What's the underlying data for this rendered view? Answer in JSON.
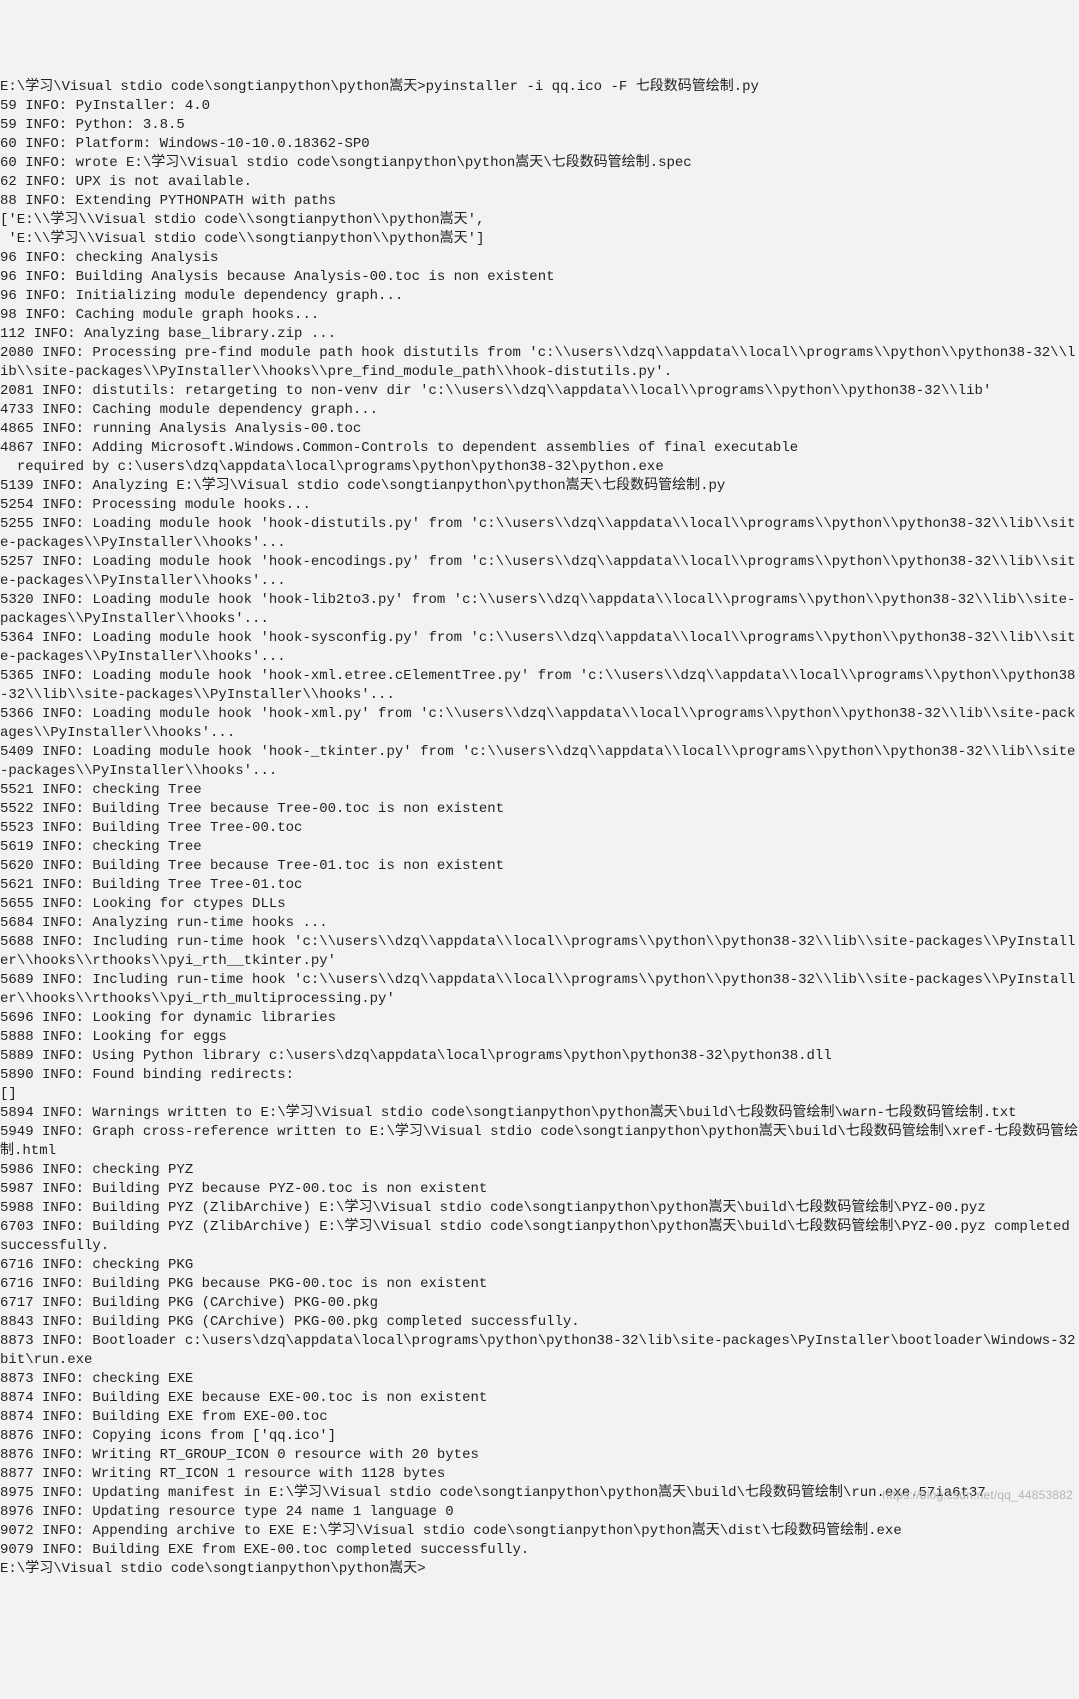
{
  "prompt1": "E:\\学习\\Visual stdio code\\songtianpython\\python嵩天>pyinstaller -i qq.ico -F 七段数码管绘制.py",
  "lines": [
    "59 INFO: PyInstaller: 4.0",
    "59 INFO: Python: 3.8.5",
    "60 INFO: Platform: Windows-10-10.0.18362-SP0",
    "60 INFO: wrote E:\\学习\\Visual stdio code\\songtianpython\\python嵩天\\七段数码管绘制.spec",
    "62 INFO: UPX is not available.",
    "88 INFO: Extending PYTHONPATH with paths",
    "['E:\\\\学习\\\\Visual stdio code\\\\songtianpython\\\\python嵩天',",
    " 'E:\\\\学习\\\\Visual stdio code\\\\songtianpython\\\\python嵩天']",
    "96 INFO: checking Analysis",
    "96 INFO: Building Analysis because Analysis-00.toc is non existent",
    "96 INFO: Initializing module dependency graph...",
    "98 INFO: Caching module graph hooks...",
    "112 INFO: Analyzing base_library.zip ...",
    "2080 INFO: Processing pre-find module path hook distutils from 'c:\\\\users\\\\dzq\\\\appdata\\\\local\\\\programs\\\\python\\\\python38-32\\\\lib\\\\site-packages\\\\PyInstaller\\\\hooks\\\\pre_find_module_path\\\\hook-distutils.py'.",
    "2081 INFO: distutils: retargeting to non-venv dir 'c:\\\\users\\\\dzq\\\\appdata\\\\local\\\\programs\\\\python\\\\python38-32\\\\lib'",
    "4733 INFO: Caching module dependency graph...",
    "4865 INFO: running Analysis Analysis-00.toc",
    "4867 INFO: Adding Microsoft.Windows.Common-Controls to dependent assemblies of final executable",
    "  required by c:\\users\\dzq\\appdata\\local\\programs\\python\\python38-32\\python.exe",
    "5139 INFO: Analyzing E:\\学习\\Visual stdio code\\songtianpython\\python嵩天\\七段数码管绘制.py",
    "5254 INFO: Processing module hooks...",
    "5255 INFO: Loading module hook 'hook-distutils.py' from 'c:\\\\users\\\\dzq\\\\appdata\\\\local\\\\programs\\\\python\\\\python38-32\\\\lib\\\\site-packages\\\\PyInstaller\\\\hooks'...",
    "5257 INFO: Loading module hook 'hook-encodings.py' from 'c:\\\\users\\\\dzq\\\\appdata\\\\local\\\\programs\\\\python\\\\python38-32\\\\lib\\\\site-packages\\\\PyInstaller\\\\hooks'...",
    "5320 INFO: Loading module hook 'hook-lib2to3.py' from 'c:\\\\users\\\\dzq\\\\appdata\\\\local\\\\programs\\\\python\\\\python38-32\\\\lib\\\\site-packages\\\\PyInstaller\\\\hooks'...",
    "5364 INFO: Loading module hook 'hook-sysconfig.py' from 'c:\\\\users\\\\dzq\\\\appdata\\\\local\\\\programs\\\\python\\\\python38-32\\\\lib\\\\site-packages\\\\PyInstaller\\\\hooks'...",
    "5365 INFO: Loading module hook 'hook-xml.etree.cElementTree.py' from 'c:\\\\users\\\\dzq\\\\appdata\\\\local\\\\programs\\\\python\\\\python38-32\\\\lib\\\\site-packages\\\\PyInstaller\\\\hooks'...",
    "5366 INFO: Loading module hook 'hook-xml.py' from 'c:\\\\users\\\\dzq\\\\appdata\\\\local\\\\programs\\\\python\\\\python38-32\\\\lib\\\\site-packages\\\\PyInstaller\\\\hooks'...",
    "5409 INFO: Loading module hook 'hook-_tkinter.py' from 'c:\\\\users\\\\dzq\\\\appdata\\\\local\\\\programs\\\\python\\\\python38-32\\\\lib\\\\site-packages\\\\PyInstaller\\\\hooks'...",
    "5521 INFO: checking Tree",
    "5522 INFO: Building Tree because Tree-00.toc is non existent",
    "5523 INFO: Building Tree Tree-00.toc",
    "5619 INFO: checking Tree",
    "5620 INFO: Building Tree because Tree-01.toc is non existent",
    "5621 INFO: Building Tree Tree-01.toc",
    "5655 INFO: Looking for ctypes DLLs",
    "5684 INFO: Analyzing run-time hooks ...",
    "5688 INFO: Including run-time hook 'c:\\\\users\\\\dzq\\\\appdata\\\\local\\\\programs\\\\python\\\\python38-32\\\\lib\\\\site-packages\\\\PyInstaller\\\\hooks\\\\rthooks\\\\pyi_rth__tkinter.py'",
    "5689 INFO: Including run-time hook 'c:\\\\users\\\\dzq\\\\appdata\\\\local\\\\programs\\\\python\\\\python38-32\\\\lib\\\\site-packages\\\\PyInstaller\\\\hooks\\\\rthooks\\\\pyi_rth_multiprocessing.py'",
    "5696 INFO: Looking for dynamic libraries",
    "5888 INFO: Looking for eggs",
    "5889 INFO: Using Python library c:\\users\\dzq\\appdata\\local\\programs\\python\\python38-32\\python38.dll",
    "5890 INFO: Found binding redirects:",
    "[]",
    "5894 INFO: Warnings written to E:\\学习\\Visual stdio code\\songtianpython\\python嵩天\\build\\七段数码管绘制\\warn-七段数码管绘制.txt",
    "5949 INFO: Graph cross-reference written to E:\\学习\\Visual stdio code\\songtianpython\\python嵩天\\build\\七段数码管绘制\\xref-七段数码管绘制.html",
    "5986 INFO: checking PYZ",
    "5987 INFO: Building PYZ because PYZ-00.toc is non existent",
    "5988 INFO: Building PYZ (ZlibArchive) E:\\学习\\Visual stdio code\\songtianpython\\python嵩天\\build\\七段数码管绘制\\PYZ-00.pyz",
    "6703 INFO: Building PYZ (ZlibArchive) E:\\学习\\Visual stdio code\\songtianpython\\python嵩天\\build\\七段数码管绘制\\PYZ-00.pyz completed successfully.",
    "6716 INFO: checking PKG",
    "6716 INFO: Building PKG because PKG-00.toc is non existent",
    "6717 INFO: Building PKG (CArchive) PKG-00.pkg",
    "8843 INFO: Building PKG (CArchive) PKG-00.pkg completed successfully.",
    "8873 INFO: Bootloader c:\\users\\dzq\\appdata\\local\\programs\\python\\python38-32\\lib\\site-packages\\PyInstaller\\bootloader\\Windows-32bit\\run.exe",
    "8873 INFO: checking EXE",
    "8874 INFO: Building EXE because EXE-00.toc is non existent",
    "8874 INFO: Building EXE from EXE-00.toc",
    "8876 INFO: Copying icons from ['qq.ico']",
    "8876 INFO: Writing RT_GROUP_ICON 0 resource with 20 bytes",
    "8877 INFO: Writing RT_ICON 1 resource with 1128 bytes",
    "8975 INFO: Updating manifest in E:\\学习\\Visual stdio code\\songtianpython\\python嵩天\\build\\七段数码管绘制\\run.exe.57ia6t37",
    "8976 INFO: Updating resource type 24 name 1 language 0",
    "9072 INFO: Appending archive to EXE E:\\学习\\Visual stdio code\\songtianpython\\python嵩天\\dist\\七段数码管绘制.exe",
    "9079 INFO: Building EXE from EXE-00.toc completed successfully.",
    ""
  ],
  "prompt2": "E:\\学习\\Visual stdio code\\songtianpython\\python嵩天>",
  "watermark": "https://blog.csdn.net/qq_44853882"
}
